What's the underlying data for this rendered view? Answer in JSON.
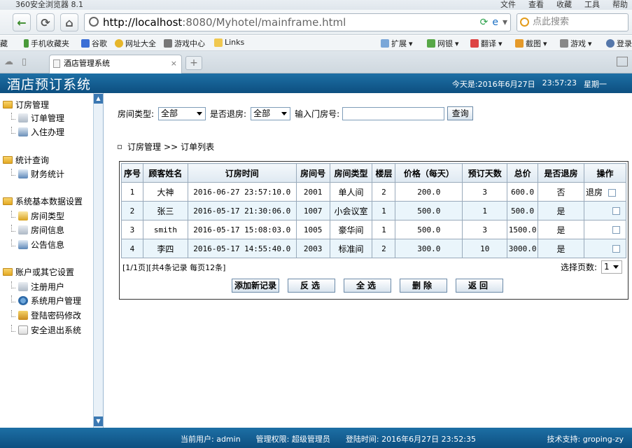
{
  "browser": {
    "app_title": "360安全浏览器 8.1",
    "menus": [
      "文件",
      "查看",
      "收藏",
      "工具",
      "帮助"
    ],
    "address_host": "http://localhost",
    "address_rest": ":8080/Myhotel/mainframe.html",
    "search_placeholder": "点此搜索",
    "bookmarks": [
      "手机收藏夹",
      "谷歌",
      "网址大全",
      "游戏中心",
      "Links",
      "扩展",
      "网银",
      "翻译",
      "截图",
      "游戏",
      "登录"
    ],
    "tab_title": "酒店管理系统"
  },
  "header": {
    "title": "酒店预订系统",
    "today_label": "今天是:2016年6月27日",
    "time": "23:57:23",
    "weekday": "星期一"
  },
  "sidebar": {
    "groups": [
      {
        "label": "订房管理",
        "items": [
          "订单管理",
          "入住办理"
        ]
      },
      {
        "label": "统计查询",
        "items": [
          "财务统计"
        ]
      },
      {
        "label": "系统基本数据设置",
        "items": [
          "房间类型",
          "房间信息",
          "公告信息"
        ]
      },
      {
        "label": "账户或其它设置",
        "items": [
          "注册用户",
          "系统用户管理",
          "登陆密码修改",
          "安全退出系统"
        ]
      }
    ]
  },
  "filter": {
    "room_type_label": "房间类型:",
    "room_type_value": "全部",
    "checkout_label": "是否退房:",
    "checkout_value": "全部",
    "room_no_label": "输入门房号:",
    "room_no_value": "",
    "query_button": "查询"
  },
  "breadcrumb": {
    "root": "订房管理",
    "sep": ">>",
    "current": "订单列表"
  },
  "table": {
    "headers": [
      "序号",
      "顾客姓名",
      "订房时间",
      "房间号",
      "房间类型",
      "楼层",
      "价格（每天）",
      "预订天数",
      "总价",
      "是否退房",
      "操作"
    ],
    "rows": [
      {
        "no": "1",
        "name": "大神",
        "time": "2016-06-27 23:57:10.0",
        "room": "2001",
        "type": "单人间",
        "floor": "2",
        "price": "200.0",
        "days": "3",
        "total": "600.0",
        "out": "否",
        "op": "退房"
      },
      {
        "no": "2",
        "name": "张三",
        "time": "2016-05-17 21:30:06.0",
        "room": "1007",
        "type": "小会议室",
        "floor": "1",
        "price": "500.0",
        "days": "1",
        "total": "500.0",
        "out": "是",
        "op": ""
      },
      {
        "no": "3",
        "name": "smith",
        "time": "2016-05-17 15:08:03.0",
        "room": "1005",
        "type": "豪华间",
        "floor": "1",
        "price": "500.0",
        "days": "3",
        "total": "1500.0",
        "out": "是",
        "op": ""
      },
      {
        "no": "4",
        "name": "李四",
        "time": "2016-05-17 14:55:40.0",
        "room": "2003",
        "type": "标准间",
        "floor": "2",
        "price": "300.0",
        "days": "10",
        "total": "3000.0",
        "out": "是",
        "op": ""
      }
    ]
  },
  "pager": {
    "info": "[1/1页][共4条记录 每页12条]",
    "select_label": "选择页数:",
    "select_value": "1"
  },
  "actions": [
    "添加新记录",
    "反选",
    "全选",
    "删除",
    "返回"
  ],
  "footer": {
    "user": "当前用户: admin",
    "role": "管理权限: 超级管理员",
    "login_time": "登陆时间: 2016年6月27日 23:52:35",
    "support": "技术支持: groping-zy"
  },
  "colors": {
    "header_bg": "#0d4f80",
    "row_alt": "#eaf5fb"
  }
}
